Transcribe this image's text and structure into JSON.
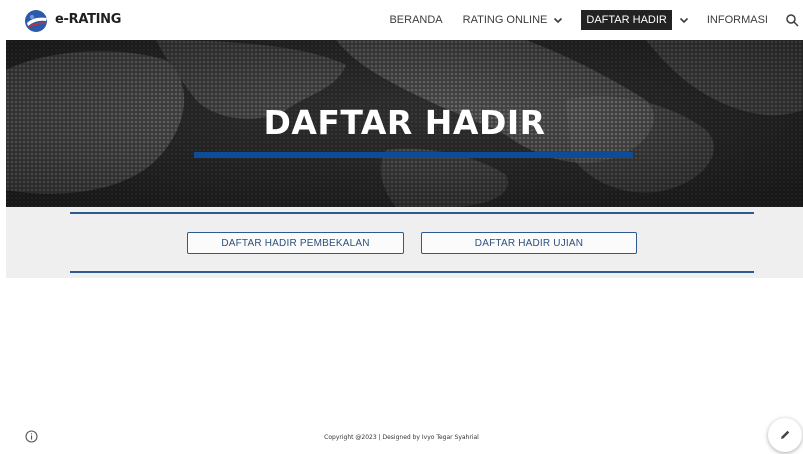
{
  "brand": {
    "name": "e-RATING"
  },
  "nav": {
    "items": [
      {
        "label": "BERANDA",
        "has_dropdown": false,
        "active": false
      },
      {
        "label": "RATING ONLINE",
        "has_dropdown": true,
        "active": false
      },
      {
        "label": "DAFTAR HADIR",
        "has_dropdown": true,
        "active": true
      },
      {
        "label": "INFORMASI",
        "has_dropdown": false,
        "active": false
      }
    ],
    "search_icon": "search-icon"
  },
  "hero": {
    "title": "DAFTAR HADIR"
  },
  "buttons": {
    "pembekalan": "DAFTAR HADIR PEMBEKALAN",
    "ujian": "DAFTAR HADIR UJIAN"
  },
  "footer": {
    "copyright": "Copyright @2023 | Designed by Ivyo Tegar Syahrial"
  },
  "colors": {
    "accent_blue": "#0d4c98",
    "rule_blue": "#2e5a91",
    "active_nav_bg": "#222222",
    "band_gray": "#efefef"
  },
  "icons": {
    "logo": "globe-logo-icon",
    "info": "info-icon",
    "edit": "pencil-icon"
  }
}
